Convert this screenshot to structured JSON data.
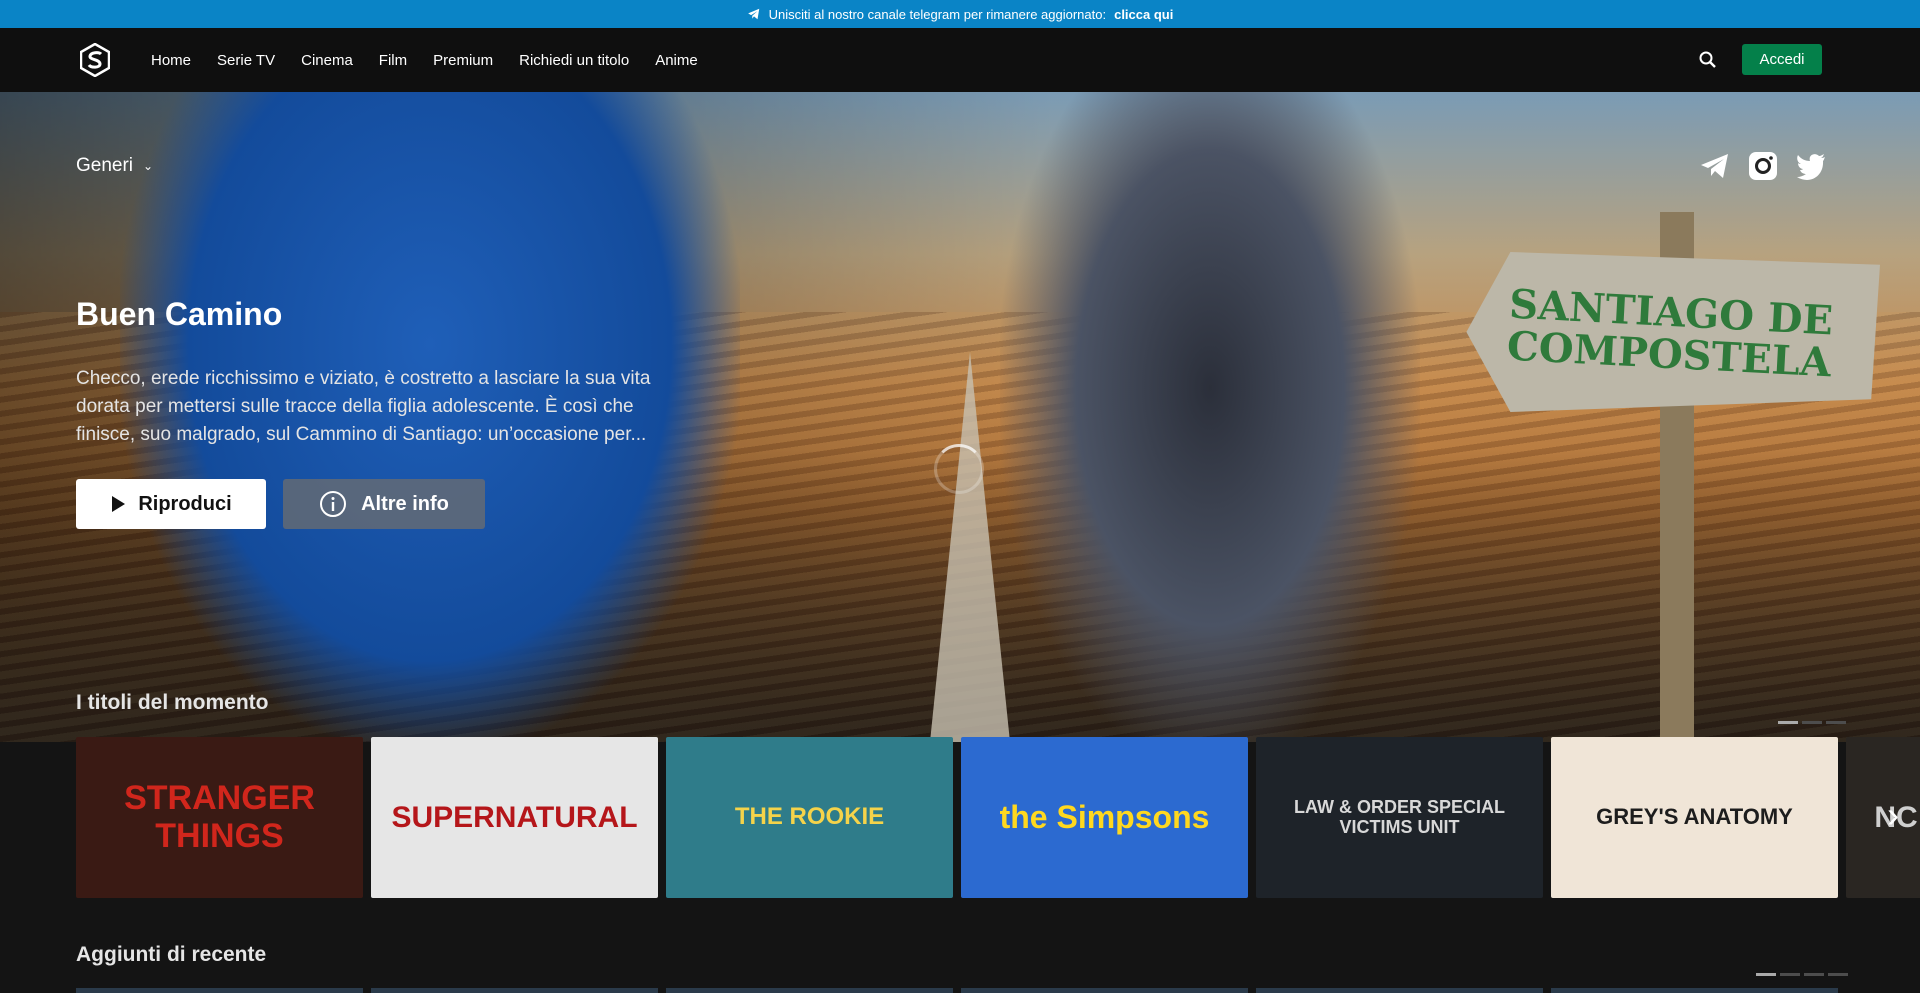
{
  "banner": {
    "text": "Unisciti al nostro canale telegram per rimanere aggiornato:",
    "link": "clicca qui"
  },
  "nav": {
    "links": [
      "Home",
      "Serie TV",
      "Cinema",
      "Film",
      "Premium",
      "Richiedi un titolo",
      "Anime"
    ],
    "login": "Accedi"
  },
  "hero": {
    "genres": "Generi",
    "sign_text": "SANTIAGO DE COMPOSTELA",
    "title": "Buen Camino",
    "description": "Checco, erede ricchissimo e viziato, è costretto a lasciare la sua vita dorata per mettersi sulle tracce della figlia adolescente. È così che finisce, suo malgrado, sul Cammino di Santiago: un’occasione per...",
    "play": "Riproduci",
    "info": "Altre info"
  },
  "rows": {
    "trending": "I titoli del momento",
    "recent": "Aggiunti di recente"
  },
  "cards": [
    {
      "title": "STRANGER THINGS",
      "bg": "#3a1a14",
      "fg": "#d1261c"
    },
    {
      "title": "SUPERNATURAL",
      "bg": "#e6e6e6",
      "fg": "#b5161a"
    },
    {
      "title": "THE ROOKIE",
      "bg": "#2f7c8a",
      "fg": "#f5d34a"
    },
    {
      "title": "the Simpsons",
      "bg": "#2c6ad0",
      "fg": "#ffd81f"
    },
    {
      "title": "LAW & ORDER SPECIAL VICTIMS UNIT",
      "bg": "#1e2329",
      "fg": "#d8d8d8"
    },
    {
      "title": "GREY'S ANATOMY",
      "bg": "#f0e5d7",
      "fg": "#1d1d1d"
    },
    {
      "title": "NC",
      "bg": "#2a2622",
      "fg": "#cfcfcf"
    }
  ],
  "colors": {
    "accent_green": "#04804a",
    "banner_blue": "#0a84c6"
  }
}
